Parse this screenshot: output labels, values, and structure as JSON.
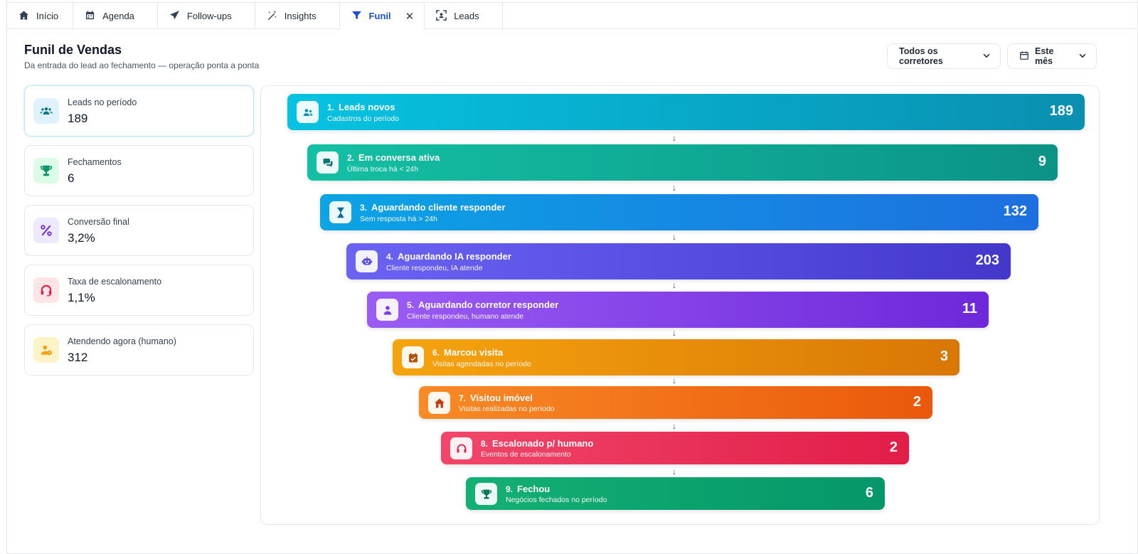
{
  "tabs": [
    {
      "label": "Início",
      "icon": "home-icon"
    },
    {
      "label": "Agenda",
      "icon": "calendar-icon"
    },
    {
      "label": "Follow-ups",
      "icon": "send-icon"
    },
    {
      "label": "Insights",
      "icon": "magic-wand-icon"
    },
    {
      "label": "Funil",
      "icon": "funnel-icon",
      "active": true
    },
    {
      "label": "Leads",
      "icon": "scan-user-icon"
    }
  ],
  "header": {
    "title": "Funil de Vendas",
    "subtitle": "Da entrada do lead ao fechamento — operação ponta a ponta"
  },
  "filters": {
    "broker": "Todos os corretores",
    "period": "Este mês"
  },
  "kpis": [
    {
      "label": "Leads no período",
      "value": "189",
      "icon": "users-icon",
      "color": "#0e7490",
      "bg": "#e0f2fe"
    },
    {
      "label": "Fechamentos",
      "value": "6",
      "icon": "trophy-icon",
      "color": "#059669",
      "bg": "#dcfce7"
    },
    {
      "label": "Conversão final",
      "value": "3,2%",
      "icon": "percent-icon",
      "color": "#6d28d9",
      "bg": "#ede9fe"
    },
    {
      "label": "Taxa de escalonamento",
      "value": "1,1%",
      "icon": "headset-icon",
      "color": "#e11d48",
      "bg": "#ffe4e6"
    },
    {
      "label": "Atendendo agora (humano)",
      "value": "312",
      "icon": "user-clock-icon",
      "color": "#f59e0b",
      "bg": "#fef3c7"
    }
  ],
  "funnel": [
    {
      "num": "1.",
      "title": "Leads novos",
      "subtitle": "Cadastros do período",
      "value": "189",
      "icon": "users-icon",
      "from": "#06c3e2",
      "to": "#0a8fb0",
      "iconColor": "#0891b2"
    },
    {
      "num": "2.",
      "title": "Em conversa ativa",
      "subtitle": "Última troca há < 24h",
      "value": "9",
      "icon": "chat-icon",
      "from": "#14c0a3",
      "to": "#0b9386",
      "iconColor": "#0f766e"
    },
    {
      "num": "3.",
      "title": "Aguardando cliente responder",
      "subtitle": "Sem resposta há > 24h",
      "value": "132",
      "icon": "hourglass-icon",
      "from": "#0ba4e4",
      "to": "#1e6fe0",
      "iconColor": "#0369a1"
    },
    {
      "num": "4.",
      "title": "Aguardando IA responder",
      "subtitle": "Cliente respondeu, IA atende",
      "value": "203",
      "icon": "robot-icon",
      "from": "#6b63f4",
      "to": "#4338ca",
      "iconColor": "#4f46e5"
    },
    {
      "num": "5.",
      "title": "Aguardando corretor responder",
      "subtitle": "Cliente respondeu, humano atende",
      "value": "11",
      "icon": "user-icon",
      "from": "#9b5cf5",
      "to": "#6d28d9",
      "iconColor": "#7c3aed"
    },
    {
      "num": "6.",
      "title": "Marcou visita",
      "subtitle": "Visitas agendadas no período",
      "value": "3",
      "icon": "calendar-check-icon",
      "from": "#f6a40e",
      "to": "#d97706",
      "iconColor": "#b45309"
    },
    {
      "num": "7.",
      "title": "Visitou imóvel",
      "subtitle": "Visitas realizadas no período",
      "value": "2",
      "icon": "house-icon",
      "from": "#f98a25",
      "to": "#ea580c",
      "iconColor": "#c2410c"
    },
    {
      "num": "8.",
      "title": "Escalonado p/ humano",
      "subtitle": "Eventos de escalonamento",
      "value": "2",
      "icon": "headset-icon",
      "from": "#f2476a",
      "to": "#e11d48",
      "iconColor": "#e11d48"
    },
    {
      "num": "9.",
      "title": "Fechou",
      "subtitle": "Negócios fechados no período",
      "value": "6",
      "icon": "trophy-icon",
      "from": "#13b074",
      "to": "#059669",
      "iconColor": "#047857"
    }
  ]
}
